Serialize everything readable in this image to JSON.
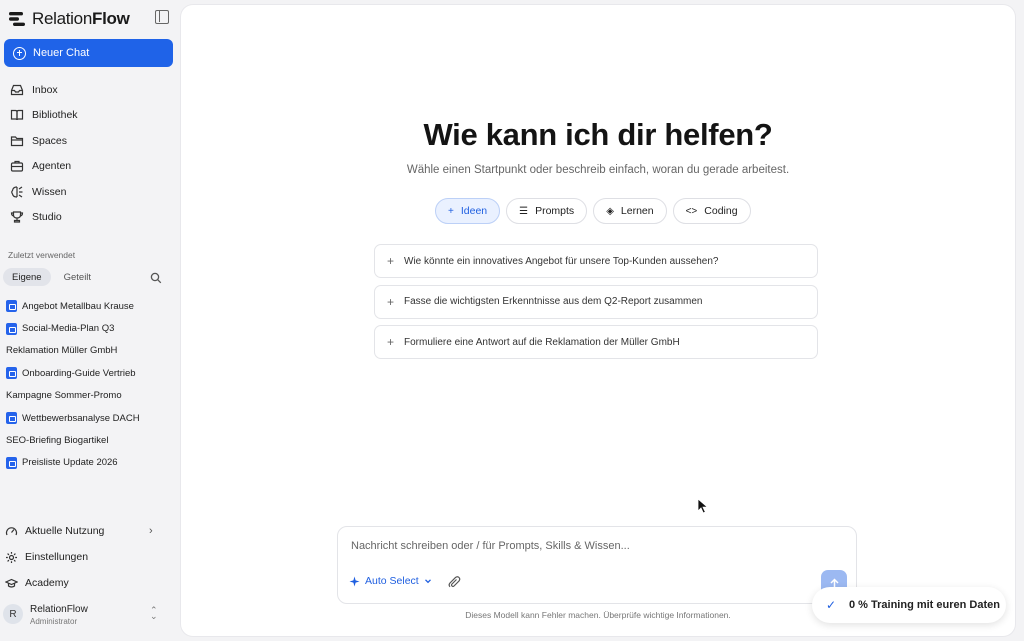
{
  "brand": {
    "name_light": "Relation",
    "name_bold": "Flow"
  },
  "sidebar": {
    "new_chat_label": "Neuer Chat",
    "nav": [
      {
        "label": "Inbox",
        "icon": "inbox-icon"
      },
      {
        "label": "Bibliothek",
        "icon": "book-icon"
      },
      {
        "label": "Spaces",
        "icon": "folder-icon"
      },
      {
        "label": "Agenten",
        "icon": "briefcase-icon"
      },
      {
        "label": "Wissen",
        "icon": "brain-icon"
      },
      {
        "label": "Studio",
        "icon": "trophy-icon"
      }
    ],
    "recent_label": "Zuletzt verwendet",
    "tabs": {
      "own": "Eigene",
      "shared": "Geteilt"
    },
    "recent": [
      {
        "label": "Angebot Metallbau Krause",
        "has_icon": true
      },
      {
        "label": "Social-Media-Plan Q3",
        "has_icon": true
      },
      {
        "label": "Reklamation Müller GmbH",
        "has_icon": false
      },
      {
        "label": "Onboarding-Guide Vertrieb",
        "has_icon": true
      },
      {
        "label": "Kampagne Sommer-Promo",
        "has_icon": false
      },
      {
        "label": "Wettbewerbsanalyse DACH",
        "has_icon": true
      },
      {
        "label": "SEO-Briefing Biogartikel",
        "has_icon": false
      },
      {
        "label": "Preisliste Update 2026",
        "has_icon": true
      }
    ],
    "bottom": {
      "usage": "Aktuelle Nutzung",
      "settings": "Einstellungen",
      "academy": "Academy"
    },
    "user": {
      "initial": "R",
      "name": "RelationFlow",
      "role": "Administrator"
    }
  },
  "main": {
    "title": "Wie kann ich dir helfen?",
    "subtitle": "Wähle einen Startpunkt oder beschreib einfach, woran du gerade arbeitest.",
    "chips": [
      {
        "label": "Ideen",
        "glyph": "+",
        "active": true
      },
      {
        "label": "Prompts",
        "glyph": "☰",
        "active": false
      },
      {
        "label": "Lernen",
        "glyph": "◈",
        "active": false
      },
      {
        "label": "Coding",
        "glyph": "<>",
        "active": false
      }
    ],
    "suggestions": [
      "Wie könnte ein innovatives Angebot für unsere Top-Kunden aussehen?",
      "Fasse die wichtigsten Erkenntnisse aus dem Q2-Report zusammen",
      "Formuliere eine Antwort auf die Reklamation der Müller GmbH"
    ],
    "composer": {
      "placeholder": "Nachricht schreiben oder / für Prompts, Skills & Wissen...",
      "model": "Auto Select"
    },
    "disclaimer": "Dieses Modell kann Fehler machen. Überprüfe wichtige Informationen."
  },
  "toast": {
    "text": "0 % Training mit euren Daten"
  },
  "colors": {
    "accent": "#1f63e8",
    "chip_active_bg": "#eaf1ff",
    "send_disabled": "#9cb9f2"
  }
}
